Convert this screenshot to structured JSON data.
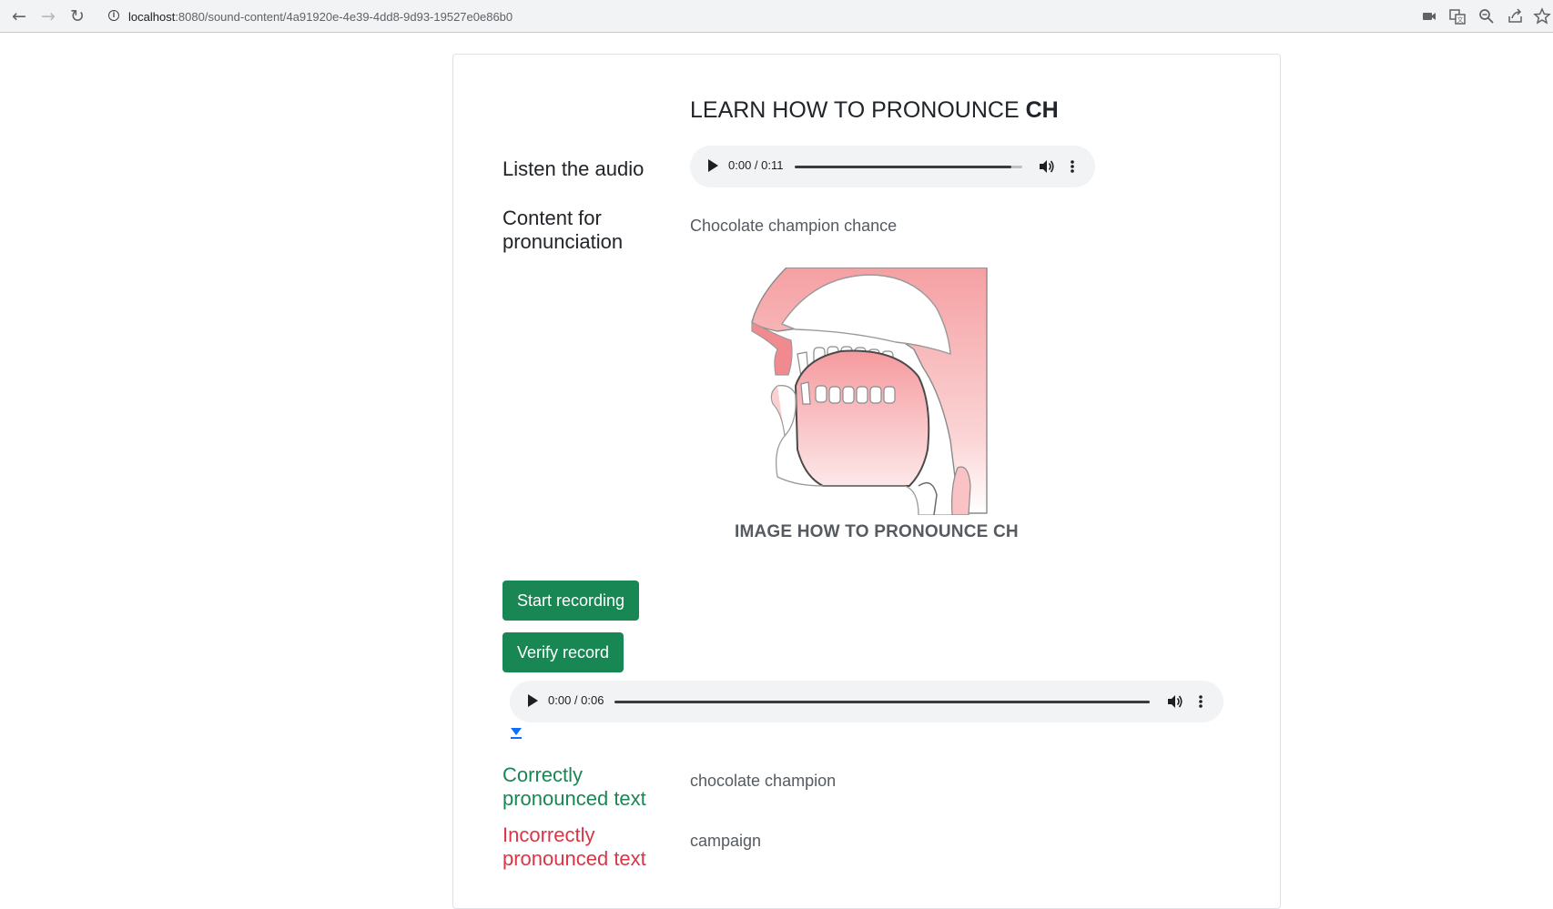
{
  "browser": {
    "url_host": "localhost",
    "url_rest": ":8080/sound-content/4a91920e-4e39-4dd8-9d93-19527e0e86b0"
  },
  "page": {
    "title_prefix": "LEARN HOW TO PRONOUNCE ",
    "title_sound": "CH",
    "listen_label": "Listen the audio",
    "reference_audio": {
      "time": "0:00 / 0:11",
      "progress": 0.95
    },
    "content_label": "Content for pronunciation",
    "content_text": "Chocolate champion chance",
    "image_caption_prefix": "IMAGE HOW TO PRONOUNCE ",
    "image_caption_sound": "CH",
    "start_recording": "Start recording",
    "verify_record": "Verify record",
    "recorded_audio": {
      "time": "0:00 / 0:06",
      "progress": 1.0
    },
    "correct_label": "Correctly pronounced text",
    "correct_text": "chocolate champion",
    "incorrect_label": "Incorrectly pronounced text",
    "incorrect_text": "campaign"
  },
  "colors": {
    "success": "#198754",
    "danger": "#dc3545",
    "accent_link": "#0d6efd"
  },
  "icons": [
    "back-arrow-icon",
    "forward-arrow-icon",
    "reload-icon",
    "info-icon",
    "camera-icon",
    "translate-icon",
    "zoom-icon",
    "share-icon",
    "star-icon",
    "play-icon",
    "volume-icon",
    "more-vert-icon",
    "download-icon"
  ]
}
